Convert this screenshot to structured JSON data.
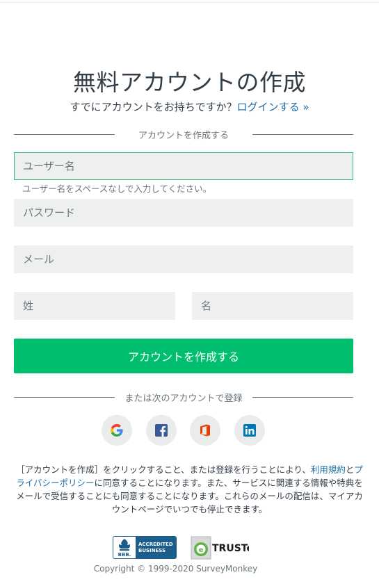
{
  "page": {
    "title": "無料アカウントの作成",
    "login_prompt": "すでにアカウントをお持ちですか？",
    "login_link": "ログインする »"
  },
  "form": {
    "divider_label": "アカウントを作成する",
    "username_placeholder": "ユーザー名",
    "username_hint": "ユーザー名をスペースなしで入力してください。",
    "password_placeholder": "パスワード",
    "email_placeholder": "メール",
    "last_name_placeholder": "姓",
    "first_name_placeholder": "名",
    "submit_label": "アカウントを作成する"
  },
  "social": {
    "divider_label": "または次のアカウントで登録",
    "providers": [
      "google-icon",
      "facebook-icon",
      "office-icon",
      "linkedin-icon"
    ]
  },
  "legal": {
    "text_1": "［アカウントを作成］をクリックすること、または登録を行うことにより、",
    "terms_link": "利用規約",
    "text_2": "と",
    "privacy_link": "プライバシーポリシー",
    "text_3": "に同意することになります。また、サービスに関連する情報や特典をメールで受信することにも同意することになります。これらのメールの配信は、マイアカウントページでいつでも停止できます。"
  },
  "badges": {
    "bbb_line1": "ACCREDITED",
    "bbb_line2": "BUSINESS",
    "bbb_mark": "BBB.",
    "truste_word": "TRUSTe"
  },
  "footer": {
    "copyright": "Copyright © 1999-2020 SurveyMonkey"
  },
  "colors": {
    "accent": "#00bf6f",
    "link": "#1b6ca8",
    "field_bg": "#eef0f0"
  }
}
